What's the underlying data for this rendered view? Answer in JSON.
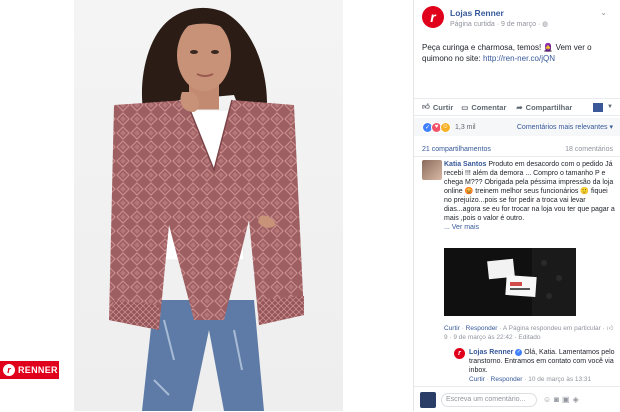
{
  "photo": {
    "brand_badge": "RENNER",
    "brand_badge_icon": "renner-r-logo",
    "palette": {
      "poncho": "#9e5f62",
      "poncho_pattern": "#c98e8d",
      "skin": "#c89278",
      "hair": "#2b1c16",
      "shirt": "#ffffff",
      "jeans": "#5d7ba6",
      "badge": "#e0001b"
    }
  },
  "post": {
    "page_name": "Lojas Renner",
    "meta": "Página curtida · 9 de março · ",
    "text_before_link": "Peça curinga e charmosa, temos! 🧕 Vem ver o quimono no site: ",
    "link": "http://ren-ner.co/jQN"
  },
  "actions": {
    "like": "Curtir",
    "comment": "Comentar",
    "share": "Compartilhar"
  },
  "reactions": {
    "count": "1,3 mil",
    "sort_label": "Comentários mais relevantes",
    "shares": "21 compartilhamentos",
    "comments": "18 comentários"
  },
  "comment": {
    "author": "Katia Santos",
    "text": " Produto em desacordo com o pedido Já recebi !!! além da demora ... Compro o tamanho P e chega M??? Obrigada pela péssima impressão da loja online 😡 treinem melhor seus funcionários 🙂 fiquei no prejuízo...pois se for pedir a troca vai levar dias...agora se eu for trocar na loja vou ter que pagar a mais ,pois o valor é outro.",
    "see_more": "... Ver mais",
    "like": "Curtir",
    "reply": "Responder",
    "page_replied": " · A Página respondeu em particular · ",
    "stats": " 9 · 9 de março às 22:42 · Editado"
  },
  "reply": {
    "author": "Lojas Renner",
    "text": " Olá, Katia. Lamentamos pelo transtorno. Entramos em contato com você via inbox.",
    "like": "Curtir",
    "reply": "Responder",
    "meta": " · 10 de março às 13:31"
  },
  "composer": {
    "placeholder": "Escreva um comentário..."
  }
}
